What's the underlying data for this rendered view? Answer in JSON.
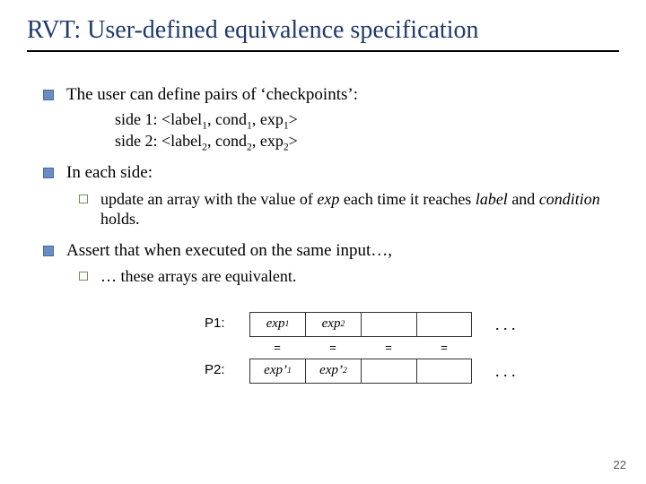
{
  "title": "RVT: User-defined equivalence specification",
  "b1": {
    "text": "The user can define pairs of ‘checkpoints’:",
    "line1_pre": "side 1: <label",
    "line1_mid": ", cond",
    "line1_mid2": ", exp",
    "line1_end": ">",
    "line2_pre": "side 2: <label",
    "line2_mid": ", cond",
    "line2_mid2": ", exp",
    "line2_end": ">"
  },
  "b2": {
    "text": "In each side:",
    "sub_pre": "update an array with the value of ",
    "sub_exp": "exp",
    "sub_mid": " each time it reaches ",
    "sub_label": "label",
    "sub_mid2": " and ",
    "sub_cond": "condition",
    "sub_end": " holds."
  },
  "b3": {
    "text": "Assert that when executed on the same input…,",
    "sub": "… these arrays are equivalent."
  },
  "diagram": {
    "p1": "P1:",
    "p2": "P2:",
    "r1c1_pre": "exp",
    "r1c1_sub": "1",
    "r1c2_pre": "exp",
    "r1c2_sub": "2",
    "r2c1_pre": "exp’",
    "r2c1_sub": "1",
    "r2c2_pre": "exp’",
    "r2c2_sub": "2",
    "eq": "=",
    "dots": ". . ."
  },
  "pagenum": "22"
}
